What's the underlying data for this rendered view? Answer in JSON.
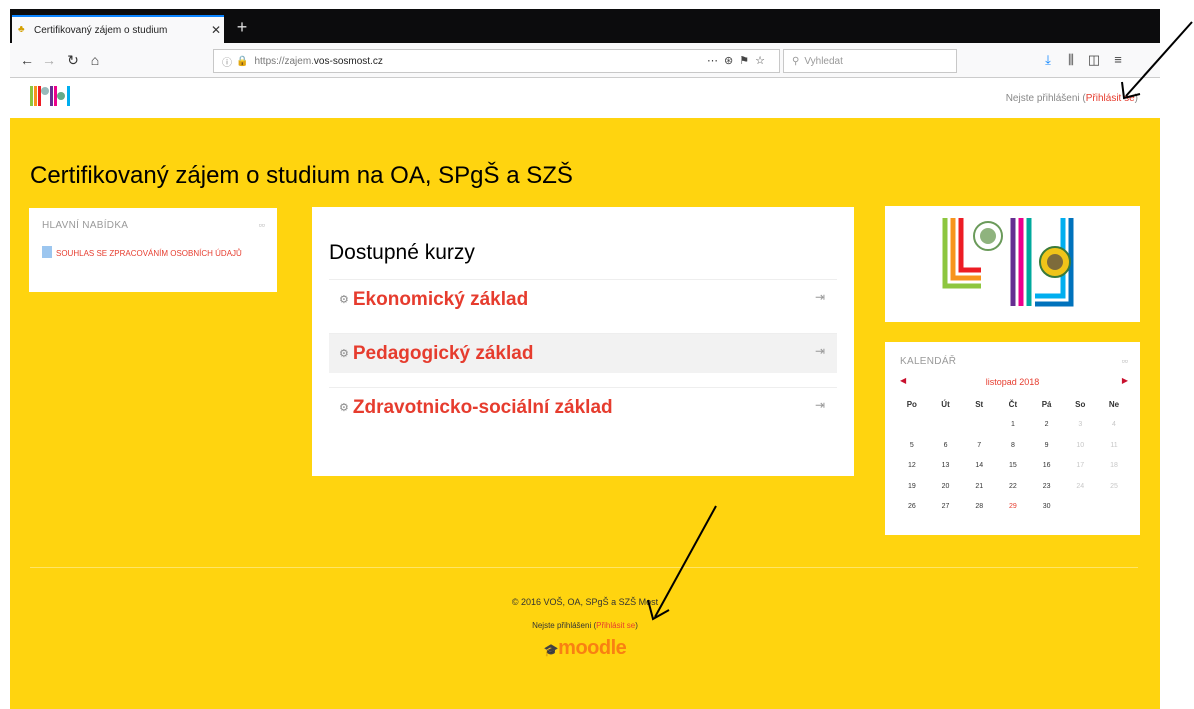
{
  "browser": {
    "tab_title": "Certifikovaný zájem o studium",
    "url_prefix": "https://zajem.",
    "url_domain": "vos-sosmost.cz",
    "search_placeholder": "Vyhledat"
  },
  "header": {
    "login_prefix": "Nejste přihlášeni (",
    "login_link": "Přihlásit se",
    "login_suffix": ")"
  },
  "page": {
    "title": "Certifikovaný zájem o studium na OA, SPgŠ a SZŠ"
  },
  "main_menu": {
    "heading": "HLAVNÍ NABÍDKA",
    "link": "SOUHLAS SE ZPRACOVÁNÍM OSOBNÍCH ÚDAJŮ"
  },
  "courses": {
    "heading": "Dostupné kurzy",
    "items": [
      "Ekonomický základ",
      "Pedagogický základ",
      "Zdravotnicko-sociální základ"
    ]
  },
  "calendar": {
    "heading": "KALENDÁŘ",
    "month": "listopad 2018",
    "days": [
      "Po",
      "Út",
      "St",
      "Čt",
      "Pá",
      "So",
      "Ne"
    ],
    "weeks": [
      [
        "",
        "",
        "",
        "1",
        "2",
        "3",
        "4"
      ],
      [
        "5",
        "6",
        "7",
        "8",
        "9",
        "10",
        "11"
      ],
      [
        "12",
        "13",
        "14",
        "15",
        "16",
        "17",
        "18"
      ],
      [
        "19",
        "20",
        "21",
        "22",
        "23",
        "24",
        "25"
      ],
      [
        "26",
        "27",
        "28",
        "29",
        "30",
        "",
        ""
      ]
    ],
    "today": "29"
  },
  "footer": {
    "copyright": "© 2016 VOŠ, OA, SPgŠ a SZŠ Most",
    "login_prefix": "Nejste přihlášeni (",
    "login_link": "Přihlásit se",
    "login_suffix": ")",
    "brand": "moodle"
  },
  "colors": {
    "page_bg": "#ffd40f",
    "link": "#e63c2e"
  }
}
